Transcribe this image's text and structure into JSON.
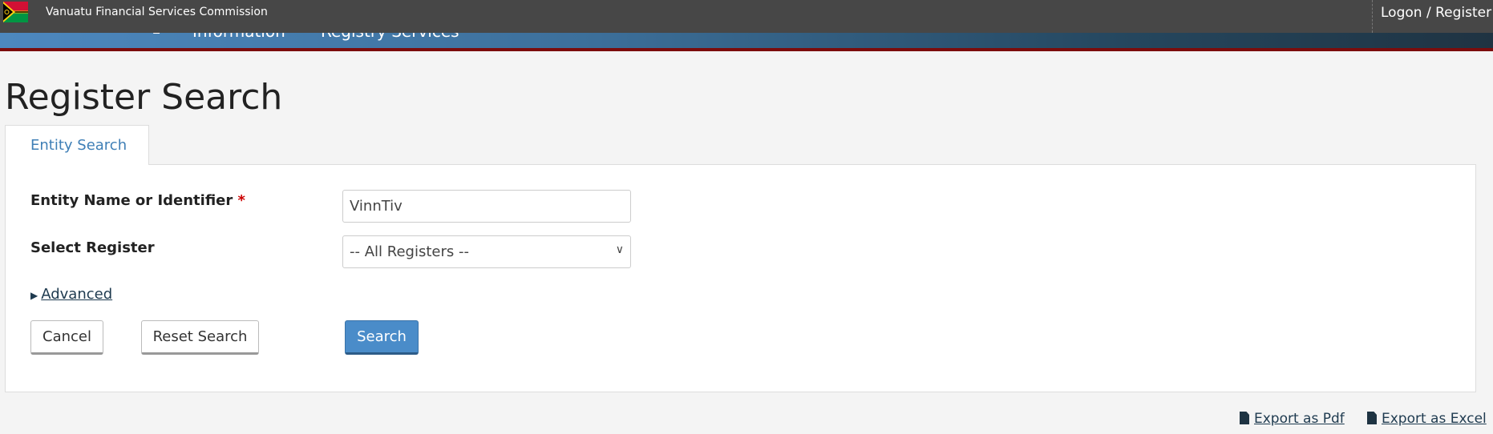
{
  "header": {
    "brand": "Vanuatu Financial Services Commission",
    "logon": "Logon / Register"
  },
  "nav": {
    "items": [
      "Information",
      "Registry Services"
    ]
  },
  "page": {
    "title": "Register Search"
  },
  "tabs": [
    {
      "label": "Entity Search",
      "active": true
    }
  ],
  "form": {
    "entity_label": "Entity Name or Identifier",
    "required_mark": "*",
    "entity_value": "VinnTiv",
    "register_label": "Select Register",
    "register_value": "-- All Registers --",
    "advanced": "Advanced",
    "cancel": "Cancel",
    "reset": "Reset Search",
    "search": "Search"
  },
  "export": {
    "pdf": "Export as Pdf",
    "excel": "Export as Excel"
  },
  "colors": {
    "accent": "#4a8cc9",
    "topbar": "#474747",
    "redline": "#7b0c0c"
  }
}
